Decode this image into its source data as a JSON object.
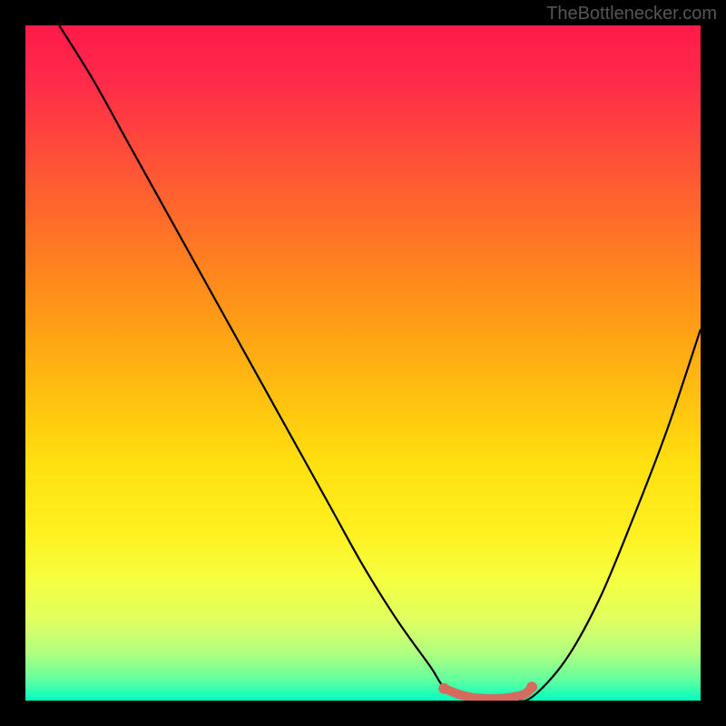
{
  "watermark": "TheBottlenecker.com",
  "chart_data": {
    "type": "line",
    "title": "",
    "xlabel": "",
    "ylabel": "",
    "xlim": [
      0,
      100
    ],
    "ylim": [
      0,
      100
    ],
    "series": [
      {
        "name": "curve",
        "x": [
          5,
          10,
          15,
          20,
          25,
          30,
          35,
          40,
          45,
          50,
          55,
          60,
          62,
          65,
          68,
          72,
          75,
          80,
          85,
          90,
          95,
          100
        ],
        "y": [
          100,
          92,
          83,
          74,
          65,
          56,
          47,
          38,
          29,
          20,
          12,
          5,
          2,
          0.5,
          0,
          0,
          0.5,
          6,
          15,
          27,
          40,
          55
        ]
      },
      {
        "name": "highlight",
        "x": [
          62,
          64,
          66,
          68,
          70,
          72,
          74,
          75
        ],
        "y": [
          1.8,
          1.0,
          0.5,
          0.3,
          0.3,
          0.5,
          1.0,
          2.0
        ]
      }
    ],
    "gradient_stops": [
      {
        "pos": 0,
        "color": "#ff1a4a"
      },
      {
        "pos": 50,
        "color": "#ffc010"
      },
      {
        "pos": 100,
        "color": "#00ffc0"
      }
    ]
  }
}
